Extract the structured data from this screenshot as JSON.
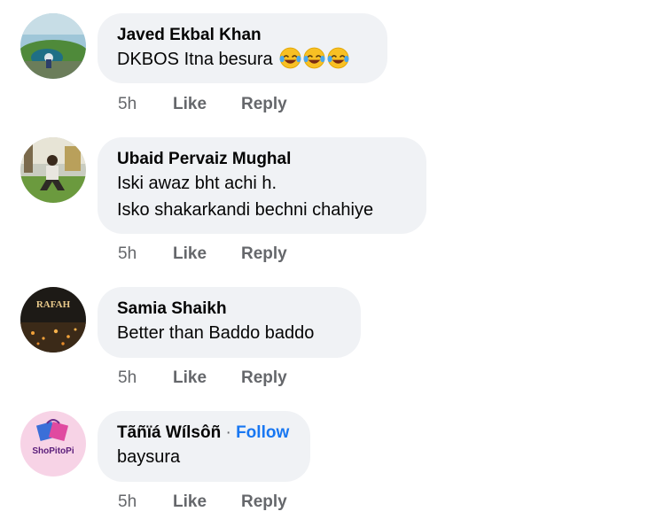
{
  "comments": [
    {
      "author": "Javed Ekbal Khan",
      "lines": [
        "DKBOS Itna besura"
      ],
      "emojis": [
        "face-with-tears-of-joy",
        "face-with-tears-of-joy",
        "face-with-tears-of-joy"
      ],
      "time": "5h",
      "like": "Like",
      "reply": "Reply"
    },
    {
      "author": "Ubaid Pervaiz Mughal",
      "lines": [
        "Iski awaz bht achi h.",
        "Isko shakarkandi bechni chahiye"
      ],
      "time": "5h",
      "like": "Like",
      "reply": "Reply"
    },
    {
      "author": "Samia Shaikh",
      "lines": [
        "Better than Baddo baddo"
      ],
      "time": "5h",
      "like": "Like",
      "reply": "Reply"
    },
    {
      "author": "Tãñïá Wílsôñ",
      "separator": "·",
      "follow": "Follow",
      "lines": [
        "baysura"
      ],
      "time": "5h",
      "like": "Like",
      "reply": "Reply"
    }
  ],
  "avatars": {
    "samia_text": "RAFAH",
    "tania_text": "ShoPitoPi"
  },
  "colors": {
    "bubble": "#f0f2f5",
    "link": "#1877f2",
    "meta": "#65676b",
    "text": "#050505"
  }
}
